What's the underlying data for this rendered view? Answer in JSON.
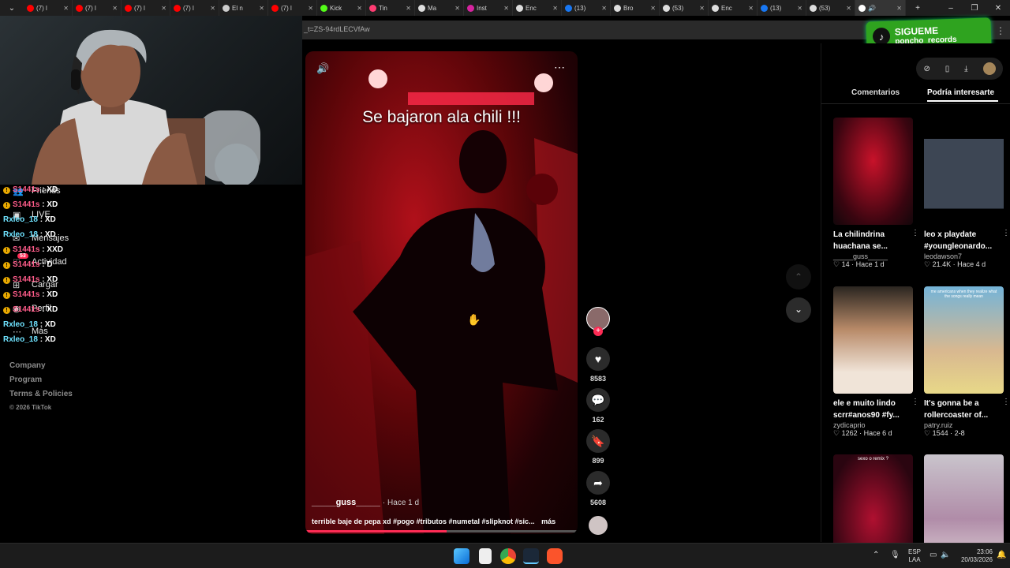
{
  "browser": {
    "tabs": [
      {
        "label": "(7) l",
        "color": "#ff0000"
      },
      {
        "label": "(7) l",
        "color": "#ff0000"
      },
      {
        "label": "(7) l",
        "color": "#ff0000"
      },
      {
        "label": "(7) l",
        "color": "#ff0000"
      },
      {
        "label": "El n",
        "color": "#cccccc"
      },
      {
        "label": "(7) l",
        "color": "#ff0000"
      },
      {
        "label": "Kick",
        "color": "#53fc18"
      },
      {
        "label": "Tin",
        "color": "#fe3c72"
      },
      {
        "label": "Ma",
        "color": "#dddddd"
      },
      {
        "label": "Inst",
        "color": "#d6249f"
      },
      {
        "label": "Enc",
        "color": "#dddddd"
      },
      {
        "label": "(13)",
        "color": "#1877f2"
      },
      {
        "label": "Bro",
        "color": "#dddddd"
      },
      {
        "label": "(53)",
        "color": "#dddddd"
      },
      {
        "label": "Enc",
        "color": "#dddddd"
      },
      {
        "label": "(13)",
        "color": "#1877f2"
      },
      {
        "label": "(53)",
        "color": "#dddddd"
      }
    ],
    "address_fragment": "_t=ZS-94rdLECVfAw"
  },
  "overlay": {
    "title": "SIGUEME",
    "handle": "poncho_records"
  },
  "sidebar": {
    "nav": [
      "Friends",
      "LIVE",
      "Mensajes",
      "Actividad",
      "Cargar",
      "Perfil",
      "Más"
    ],
    "activity_badge": "53",
    "footer": [
      "Company",
      "Program",
      "Terms & Policies",
      "© 2026 TikTok"
    ]
  },
  "chat": [
    {
      "user": "S1441s",
      "msg": "XD",
      "type": "badge"
    },
    {
      "user": "S1441s",
      "msg": "XD",
      "type": "badge"
    },
    {
      "user": "Rxleo_18",
      "msg": "XD",
      "type": "plain"
    },
    {
      "user": "Rxleo_18",
      "msg": "XD",
      "type": "plain"
    },
    {
      "user": "S1441s",
      "msg": "XXD",
      "type": "badge"
    },
    {
      "user": "S1441s",
      "msg": "D",
      "type": "badge"
    },
    {
      "user": "S1441s",
      "msg": "XD",
      "type": "badge"
    },
    {
      "user": "S1441s",
      "msg": "XD",
      "type": "badge"
    },
    {
      "user": "S1441s",
      "msg": "XD",
      "type": "badge"
    },
    {
      "user": "Rxleo_18",
      "msg": "XD",
      "type": "plain"
    },
    {
      "user": "Rxleo_18",
      "msg": "XD",
      "type": "plain"
    }
  ],
  "video": {
    "caption": "Se bajaron ala chili !!!",
    "author": "_____guss_____",
    "time": "· Hace 1 d",
    "description": "terrible baje de pepa xd #pogo #tributos #numetal #slipknot #sic...",
    "more": "más",
    "progress": 0.52,
    "likes": "8583",
    "comments": "162",
    "saves": "899",
    "shares": "5608"
  },
  "panel": {
    "tabs": [
      "Comentarios",
      "Podría interesarte"
    ],
    "active_tab": 1,
    "cards": [
      {
        "title": "La chilindrina huachana se...",
        "user": "_____guss_____",
        "likes": "14",
        "time": "Hace 1 d"
      },
      {
        "title": "leo x playdate #youngleonardo...",
        "user": "leodawson7",
        "likes": "21.4K",
        "time": "Hace 4 d"
      },
      {
        "title": "ele e muito lindo scrr#anos90 #fy...",
        "user": "zydicaprio",
        "likes": "1262",
        "time": "Hace 6 d"
      },
      {
        "title": "It's gonna be a rollercoaster of...",
        "user": "patry.ruiz",
        "likes": "1544",
        "time": "2-8"
      },
      {
        "title": "",
        "user": "",
        "likes": "",
        "time": ""
      },
      {
        "title": "",
        "user": "",
        "likes": "",
        "time": ""
      }
    ],
    "thumb_text_3": "me americans when they realize what the songs really mean",
    "thumb_text_4": "sexo o remix ?"
  },
  "taskbar": {
    "lang": "ESP",
    "layout": "LAA",
    "time": "23:06",
    "date": "20/03/2026"
  },
  "colors": {
    "accent": "#fe2c55",
    "panel_bg": "#000000",
    "chrome": "#1f1f1f",
    "overlay_green": "#2fa31f"
  }
}
